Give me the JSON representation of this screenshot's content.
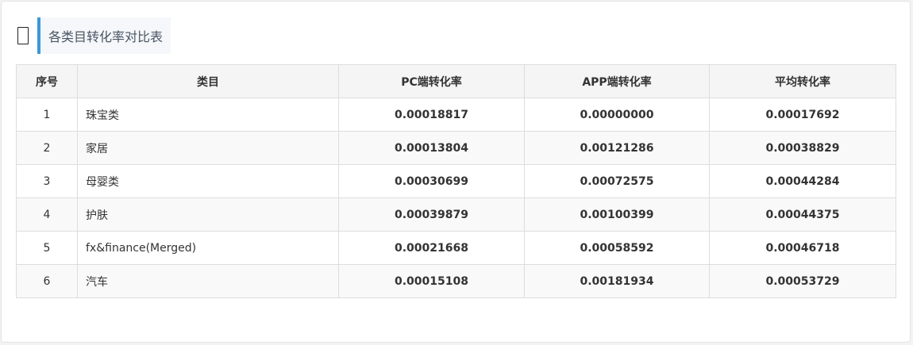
{
  "header": {
    "icon": "book-icon",
    "title": "各类目转化率对比表"
  },
  "table": {
    "columns": [
      "序号",
      "类目",
      "PC端转化率",
      "APP端转化率",
      "平均转化率"
    ],
    "rows": [
      {
        "index": "1",
        "category": "珠宝类",
        "pc": "0.00018817",
        "app": "0.00000000",
        "avg": "0.00017692"
      },
      {
        "index": "2",
        "category": "家居",
        "pc": "0.00013804",
        "app": "0.00121286",
        "avg": "0.00038829"
      },
      {
        "index": "3",
        "category": "母婴类",
        "pc": "0.00030699",
        "app": "0.00072575",
        "avg": "0.00044284"
      },
      {
        "index": "4",
        "category": "护肤",
        "pc": "0.00039879",
        "app": "0.00100399",
        "avg": "0.00044375"
      },
      {
        "index": "5",
        "category": "fx&finance(Merged)",
        "pc": "0.00021668",
        "app": "0.00058592",
        "avg": "0.00046718"
      },
      {
        "index": "6",
        "category": "汽车",
        "pc": "0.00015108",
        "app": "0.00181934",
        "avg": "0.00053729"
      }
    ]
  }
}
